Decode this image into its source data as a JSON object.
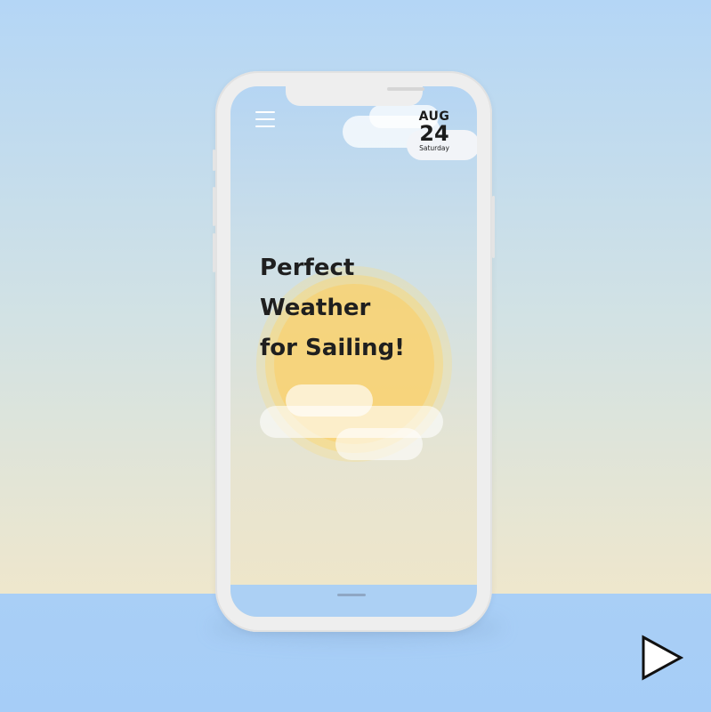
{
  "date": {
    "month": "AUG",
    "day": "24",
    "weekday": "Saturday"
  },
  "headline": {
    "line1": "Perfect",
    "line2": "Weather",
    "line3": "for Sailing!"
  },
  "icons": {
    "menu": "hamburger-menu-icon",
    "play": "play-icon",
    "sun": "sun-illustration",
    "cloud": "cloud-illustration"
  },
  "colors": {
    "sky_top": "#b4d6f6",
    "sand": "#f2e8c8",
    "floor": "#a9cff6",
    "sun_core": "#fdd471",
    "headline_text": "#1f1f1f"
  }
}
